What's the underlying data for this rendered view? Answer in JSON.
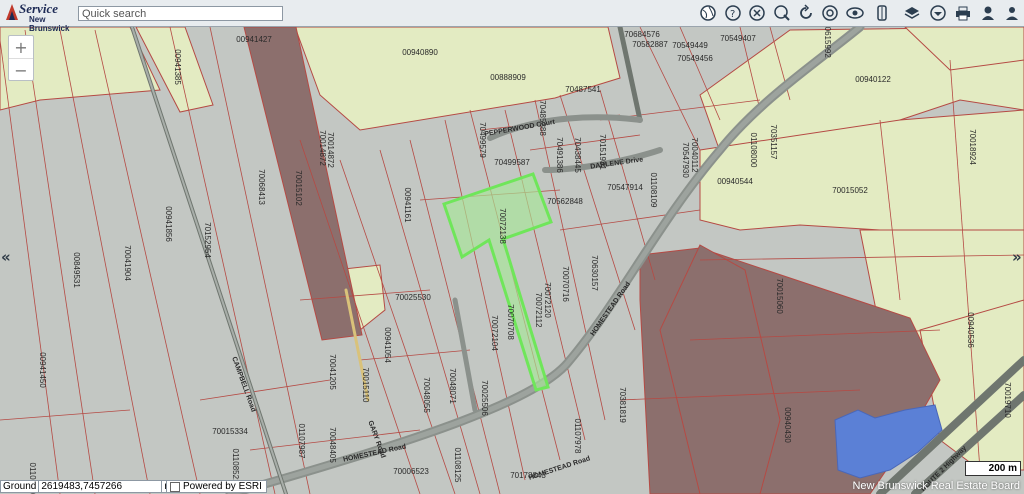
{
  "app": {
    "brand_top": "Service",
    "brand_bottom": "New Brunswick"
  },
  "search": {
    "placeholder": "Quick search",
    "value": ""
  },
  "toolbar": {
    "icons": [
      "globe-icon",
      "help-icon",
      "clear-icon",
      "identify-icon",
      "refresh-icon",
      "lifebuoy-icon",
      "view-icon",
      "measure-icon",
      "layers-icon",
      "basemap-icon",
      "print-icon",
      "user-icon"
    ]
  },
  "zoom": {
    "in": "+",
    "out": "−"
  },
  "nav": {
    "left": "«",
    "right": "»"
  },
  "status": {
    "coord_label": "Ground",
    "coord_value": "2619483,7457266",
    "coord_unit": "m",
    "powered_by": "Powered by ESRI"
  },
  "scale": {
    "label": "200 m"
  },
  "watermark": "New Brunswick Real Estate Board",
  "map": {
    "colors": {
      "base": "#c3c7c3",
      "field": "#e3ebc2",
      "bare": "#8c6f6d",
      "water": "#5b80d6",
      "highlight": "#7fe66c",
      "road": "#8b918c",
      "lot_line": "#b54a44"
    },
    "roads": [
      {
        "name": "HOMESTEAD Road"
      },
      {
        "name": "HOMESTEAD Road"
      },
      {
        "name": "HOMESTEAD Road"
      },
      {
        "name": "DARLENE Drive"
      },
      {
        "name": "PEPPERWOOD Court"
      },
      {
        "name": "CAMPBELL Road"
      },
      {
        "name": "GARY Road"
      },
      {
        "name": "ROUTE 2 Highway"
      }
    ],
    "parcel_labels": [
      "00941427",
      "00940890",
      "00888909",
      "00941385",
      "70014872",
      "70014872",
      "70015102",
      "70068413",
      "00941856",
      "70041904",
      "70152954",
      "00849531",
      "00941161",
      "00941450",
      "70015334",
      "01107987",
      "70048405",
      "00941054",
      "70015110",
      "70041205",
      "70048055",
      "70048071",
      "70025506",
      "70072104",
      "70070708",
      "70072112",
      "70072120",
      "70072138",
      "70070716",
      "70025530",
      "70499579",
      "70499587",
      "70485388",
      "70491386",
      "70438445",
      "70151931",
      "70487541",
      "70562848",
      "70547914",
      "01108109",
      "70547930",
      "70630157",
      "70684576",
      "70582887",
      "70549449",
      "70549407",
      "70549456",
      "70615992",
      "00940122",
      "70351157",
      "01108000",
      "70040112",
      "00940544",
      "70015052",
      "70018924",
      "70015060",
      "00940536",
      "70019710",
      "00940430",
      "70381819",
      "01107978",
      "70178843",
      "70006523",
      "01108125",
      "01108521",
      "01107920"
    ]
  }
}
